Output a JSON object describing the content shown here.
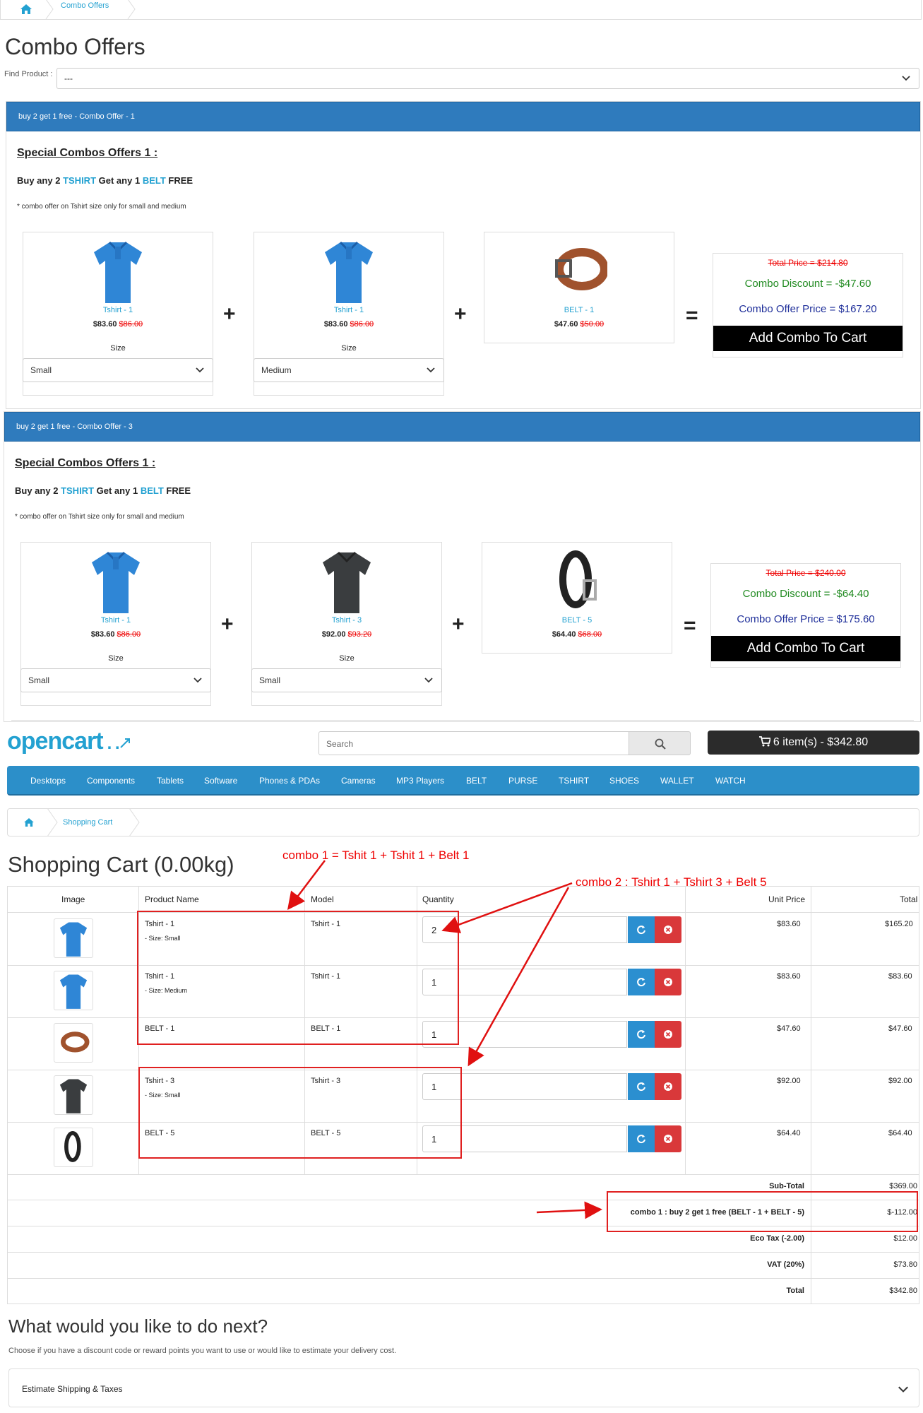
{
  "breadcrumb_top": {
    "items": [
      "Combo Offers"
    ]
  },
  "page_title": "Combo Offers",
  "find_product": {
    "label": "Find Product :",
    "value": "---"
  },
  "combos": [
    {
      "header": "buy 2 get 1 free - Combo Offer - 1",
      "title": "Special Combos Offers 1 :",
      "buy": {
        "pre": "Buy any",
        "n1": "2",
        "cat1": "TSHIRT",
        "mid": "Get any",
        "n2": "1",
        "cat2": "BELT",
        "post": "FREE"
      },
      "note": "* combo offer on Tshirt size only for small and medium",
      "products": [
        {
          "name": "Tshirt - 1",
          "price": "$83.60",
          "old_price": "$86.00",
          "size_label": "Size",
          "size": "Small",
          "img": "tshirt-blue-icon"
        },
        {
          "name": "Tshirt - 1",
          "price": "$83.60",
          "old_price": "$86.00",
          "size_label": "Size",
          "size": "Medium",
          "img": "tshirt-blue-icon"
        },
        {
          "name": "BELT - 1",
          "price": "$47.60",
          "old_price": "$50.00",
          "img": "belt-brown-icon"
        }
      ],
      "plus": "+",
      "equals": "=",
      "summary": {
        "total": "Total Price = $214.80",
        "discount": "Combo Discount = -$47.60",
        "offer": "Combo Offer Price = $167.20",
        "button": "Add Combo To Cart"
      }
    },
    {
      "header": "buy 2 get 1 free - Combo Offer - 3",
      "title": "Special Combos Offers 1 :",
      "buy": {
        "pre": "Buy any",
        "n1": "2",
        "cat1": "TSHIRT",
        "mid": "Get any",
        "n2": "1",
        "cat2": "BELT",
        "post": "FREE"
      },
      "note": "* combo offer on Tshirt size only for small and medium",
      "products": [
        {
          "name": "Tshirt - 1",
          "price": "$83.60",
          "old_price": "$86.00",
          "size_label": "Size",
          "size": "Small",
          "img": "tshirt-blue-icon"
        },
        {
          "name": "Tshirt - 3",
          "price": "$92.00",
          "old_price": "$93.20",
          "size_label": "Size",
          "size": "Small",
          "img": "tshirt-dark-icon"
        },
        {
          "name": "BELT - 5",
          "price": "$64.40",
          "old_price": "$68.00",
          "img": "belt-black-icon"
        }
      ],
      "plus": "+",
      "equals": "=",
      "summary": {
        "total": "Total Price = $240.00",
        "discount": "Combo Discount = -$64.40",
        "offer": "Combo Offer Price = $175.60",
        "button": "Add Combo To Cart"
      }
    }
  ],
  "header": {
    "logo": "opencart",
    "search_placeholder": "Search",
    "cart": "6 item(s) - $342.80"
  },
  "nav": [
    "Desktops",
    "Components",
    "Tablets",
    "Software",
    "Phones & PDAs",
    "Cameras",
    "MP3 Players",
    "BELT",
    "PURSE",
    "TSHIRT",
    "SHOES",
    "WALLET",
    "WATCH"
  ],
  "cart_breadcrumb": "Shopping Cart",
  "cart_title": "Shopping Cart  (0.00kg)",
  "table": {
    "headers": {
      "image": "Image",
      "name": "Product Name",
      "model": "Model",
      "quantity": "Quantity",
      "unit": "Unit Price",
      "total": "Total"
    },
    "rows": [
      {
        "name": "Tshirt - 1",
        "option": "- Size: Small",
        "model": "Tshirt - 1",
        "qty": "2",
        "unit": "$83.60",
        "total": "$165.20",
        "img": "tshirt-blue-icon"
      },
      {
        "name": "Tshirt - 1",
        "option": "- Size: Medium",
        "model": "Tshirt - 1",
        "qty": "1",
        "unit": "$83.60",
        "total": "$83.60",
        "img": "tshirt-blue-icon"
      },
      {
        "name": "BELT - 1",
        "option": "",
        "model": "BELT - 1",
        "qty": "1",
        "unit": "$47.60",
        "total": "$47.60",
        "img": "belt-brown-icon"
      },
      {
        "name": "Tshirt - 3",
        "option": "- Size: Small",
        "model": "Tshirt - 3",
        "qty": "1",
        "unit": "$92.00",
        "total": "$92.00",
        "img": "tshirt-dark-icon"
      },
      {
        "name": "BELT - 5",
        "option": "",
        "model": "BELT - 5",
        "qty": "1",
        "unit": "$64.40",
        "total": "$64.40",
        "img": "belt-black-icon"
      }
    ],
    "totals": [
      {
        "label": "Sub-Total",
        "value": "$369.00"
      },
      {
        "label": "combo 1 : buy 2 get 1 free (BELT - 1 + BELT - 5)",
        "value": "$-112.00"
      },
      {
        "label": "Eco Tax (-2.00)",
        "value": "$12.00"
      },
      {
        "label": "VAT (20%)",
        "value": "$73.80"
      },
      {
        "label": "Total",
        "value": "$342.80"
      }
    ]
  },
  "annotations": {
    "combo1": "combo 1 = Tshit 1 + Tshit 1 + Belt 1",
    "combo2": "combo 2 : Tshirt 1 + Tshirt 3 + Belt 5"
  },
  "next": {
    "title": "What would you like to do next?",
    "desc": "Choose if you have a discount code or reward points you want to use or would like to estimate your delivery cost.",
    "estimate": "Estimate Shipping & Taxes"
  },
  "colors": {
    "link": "#23a1d1",
    "panel_header": "#2f7bbd",
    "nav": "#2c8fc9",
    "discount": "#228b22",
    "offer": "#1f2f9a",
    "strike": "#e00000"
  }
}
